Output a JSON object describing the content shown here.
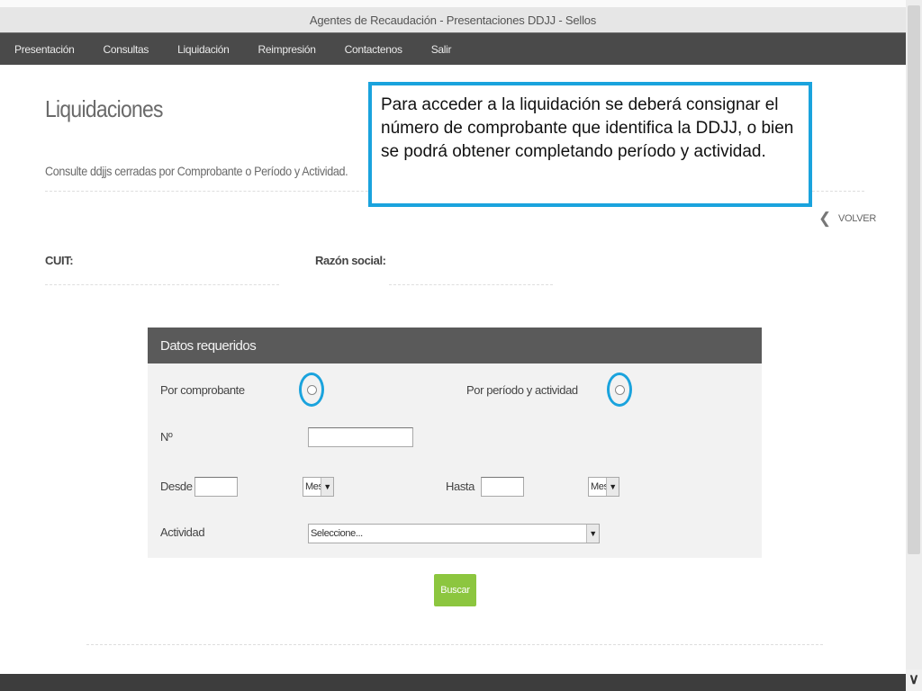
{
  "window": {
    "title": "Agentes de Recaudación - Presentaciones DDJJ - Sellos"
  },
  "nav": {
    "items": [
      {
        "label": "Presentación"
      },
      {
        "label": "Consultas"
      },
      {
        "label": "Liquidación"
      },
      {
        "label": "Reimpresión"
      },
      {
        "label": "Contactenos"
      },
      {
        "label": "Salir"
      }
    ]
  },
  "page": {
    "title": "Liquidaciones",
    "subtitle": "Consulte ddjjs cerradas por Comprobante o Período y Actividad."
  },
  "callout": {
    "text": "Para acceder a la liquidación se deberá consignar el número de comprobante que identifica la DDJJ, o bien se podrá obtener completando período y actividad.",
    "border_color": "#1aa3dd"
  },
  "back": {
    "label": "VOLVER",
    "icon": "chevron-left-icon"
  },
  "info": {
    "cuit_label": "CUIT:",
    "cuit_value": "",
    "razon_label": "Razón social:",
    "razon_value": ""
  },
  "form": {
    "header": "Datos requeridos",
    "por_comprobante_label": "Por comprobante",
    "por_periodo_label": "Por período y actividad",
    "numero_label": "Nº",
    "numero_value": "",
    "desde_label": "Desde",
    "desde_value": "",
    "desde_mes": "Mes",
    "hasta_label": "Hasta",
    "hasta_value": "",
    "hasta_mes": "Mes",
    "actividad_label": "Actividad",
    "actividad_selected": "Seleccione...",
    "search_label": "Buscar",
    "search_color": "#8cc63f",
    "header_color": "#5a5a5a"
  }
}
